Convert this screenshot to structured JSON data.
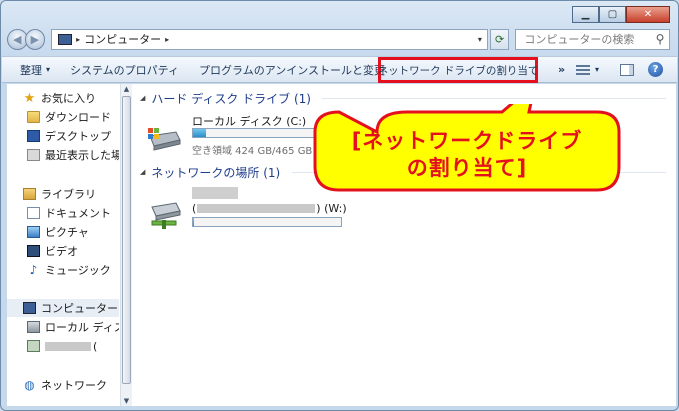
{
  "window": {
    "controls": {
      "minimize": "▁",
      "maximize": "▢",
      "close": "✕"
    }
  },
  "address": {
    "back_icon": "◀",
    "forward_icon": "▶",
    "path": "コンピューター",
    "separator": "▸",
    "dropdown": "▾",
    "refresh": "⟳"
  },
  "search": {
    "placeholder": "コンピューターの検索",
    "icon": "⚲"
  },
  "toolbar": {
    "organize": "整理",
    "caret": "▾",
    "system_properties": "システムのプロパティ",
    "uninstall": "プログラムのアンインストールと変更",
    "map_network_drive": "ネットワーク ドライブの割り当て",
    "more": "»",
    "help": "?"
  },
  "navpane": {
    "favorites": "お気に入り",
    "downloads": "ダウンロード",
    "desktop": "デスクトップ",
    "recent": "最近表示した場所",
    "libraries": "ライブラリ",
    "documents": "ドキュメント",
    "pictures": "ピクチャ",
    "videos": "ビデオ",
    "music": "ミュージック",
    "computer": "コンピューター",
    "local_disk": "ローカル ディスク",
    "network_drive_suffix": "(",
    "network": "ネットワーク",
    "star_icon": "★",
    "music_icon": "♪",
    "network_icon": "◍"
  },
  "content": {
    "hdd_group": "ハード ディスク ドライブ (1)",
    "network_group": "ネットワークの場所 (1)",
    "group_tri": "◢",
    "local_disk_name": "ローカル ディスク (C:)",
    "local_disk_space": "空き領域 424 GB/465 GB",
    "local_disk_used_fraction": 0.09,
    "network_drive_open": "(",
    "network_drive_label": ") (W:)",
    "network_drive_used_fraction": 0.01
  },
  "callout": {
    "line1": "[ネットワークドライブ",
    "line2": "の割り当て]",
    "fill_color": "#ffff00",
    "border_color": "#e4101d",
    "text_color": "#e4101d"
  },
  "colors": {
    "highlight_border": "#e4101d",
    "group_header": "#1e3e8c"
  }
}
